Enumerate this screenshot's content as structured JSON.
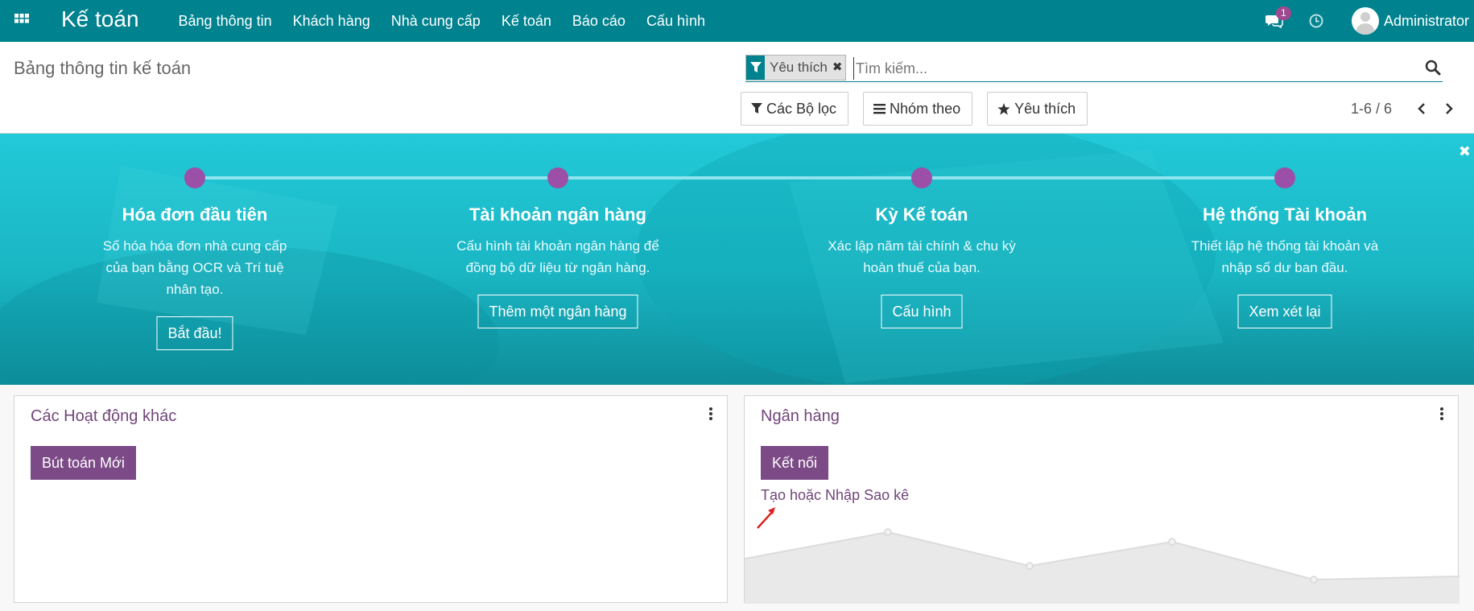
{
  "navbar": {
    "app_title": "Kế toán",
    "menu": [
      "Bảng thông tin",
      "Khách hàng",
      "Nhà cung cấp",
      "Kế toán",
      "Báo cáo",
      "Cấu hình"
    ],
    "message_count": "1",
    "user_name": "Administrator"
  },
  "control_panel": {
    "breadcrumb": "Bảng thông tin kế toán",
    "facet_value": "Yêu thích",
    "search_placeholder": "Tìm kiếm...",
    "filters_label": "Các Bộ lọc",
    "groupby_label": "Nhóm theo",
    "favorites_label": "Yêu thích",
    "pager": "1-6 / 6"
  },
  "onboarding": {
    "steps": [
      {
        "title": "Hóa đơn đầu tiên",
        "desc": "Số hóa hóa đơn nhà cung cấp của bạn bằng OCR và Trí tuệ nhân tạo.",
        "button": "Bắt đầu!"
      },
      {
        "title": "Tài khoản ngân hàng",
        "desc": "Cấu hình tài khoản ngân hàng để đồng bộ dữ liệu từ ngân hàng.",
        "button": "Thêm một ngân hàng"
      },
      {
        "title": "Kỳ Kế toán",
        "desc": "Xác lập năm tài chính & chu kỳ hoàn thuế của bạn.",
        "button": "Cấu hình"
      },
      {
        "title": "Hệ thống Tài khoản",
        "desc": "Thiết lập hệ thống tài khoản và nhập số dư ban đầu.",
        "button": "Xem xét lại"
      }
    ]
  },
  "cards": {
    "misc": {
      "title": "Các Hoạt động khác",
      "button": "Bút toán Mới"
    },
    "bank": {
      "title": "Ngân hàng",
      "button": "Kết nối",
      "link": "Tạo hoặc Nhập Sao kê"
    }
  },
  "colors": {
    "navbar": "#00838f",
    "primary": "#7c4a86",
    "banner": "#1ab6c4",
    "step_dot": "#9b4fa6"
  }
}
